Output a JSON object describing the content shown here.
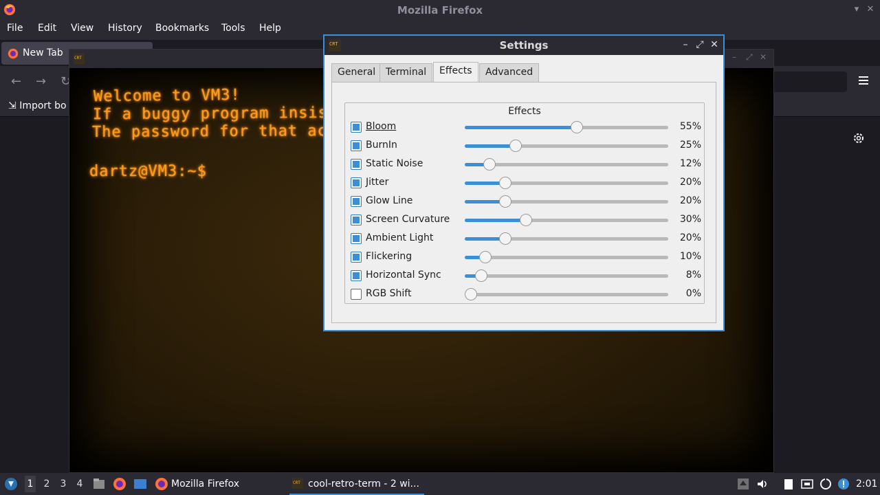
{
  "firefox": {
    "window_title": "Mozilla Firefox",
    "menu": [
      "File",
      "Edit",
      "View",
      "History",
      "Bookmarks",
      "Tools",
      "Help"
    ],
    "tab_label": "New Tab",
    "bookmark_label": "Import bo"
  },
  "terminal": {
    "lines": [
      "Welcome to VM3!",
      "If a buggy program insists",
      "The password for that acco",
      "",
      "dartz@VM3:~$"
    ]
  },
  "settings": {
    "title": "Settings",
    "tabs": [
      "General",
      "Terminal",
      "Effects",
      "Advanced"
    ],
    "active_tab": "Effects",
    "group_title": "Effects",
    "effects": [
      {
        "label": "Bloom",
        "enabled": true,
        "value": 55,
        "display": "55%"
      },
      {
        "label": "BurnIn",
        "enabled": true,
        "value": 25,
        "display": "25%"
      },
      {
        "label": "Static Noise",
        "enabled": true,
        "value": 12,
        "display": "12%"
      },
      {
        "label": "Jitter",
        "enabled": true,
        "value": 20,
        "display": "20%"
      },
      {
        "label": "Glow Line",
        "enabled": true,
        "value": 20,
        "display": "20%"
      },
      {
        "label": "Screen Curvature",
        "enabled": true,
        "value": 30,
        "display": "30%"
      },
      {
        "label": "Ambient Light",
        "enabled": true,
        "value": 20,
        "display": "20%"
      },
      {
        "label": "Flickering",
        "enabled": true,
        "value": 10,
        "display": "10%"
      },
      {
        "label": "Horizontal Sync",
        "enabled": true,
        "value": 8,
        "display": "8%"
      },
      {
        "label": "RGB Shift",
        "enabled": false,
        "value": 0,
        "display": "0%"
      }
    ]
  },
  "taskbar": {
    "workspaces": [
      "1",
      "2",
      "3",
      "4"
    ],
    "active_workspace": "1",
    "tasks": [
      {
        "label": "Mozilla Firefox"
      },
      {
        "label": "cool-retro-term - 2 wi..."
      }
    ],
    "clock": "2:01"
  },
  "colors": {
    "accent": "#3a8fd6",
    "terminal_text": "#ff9a1f",
    "dark_chrome": "#2b2a33"
  }
}
